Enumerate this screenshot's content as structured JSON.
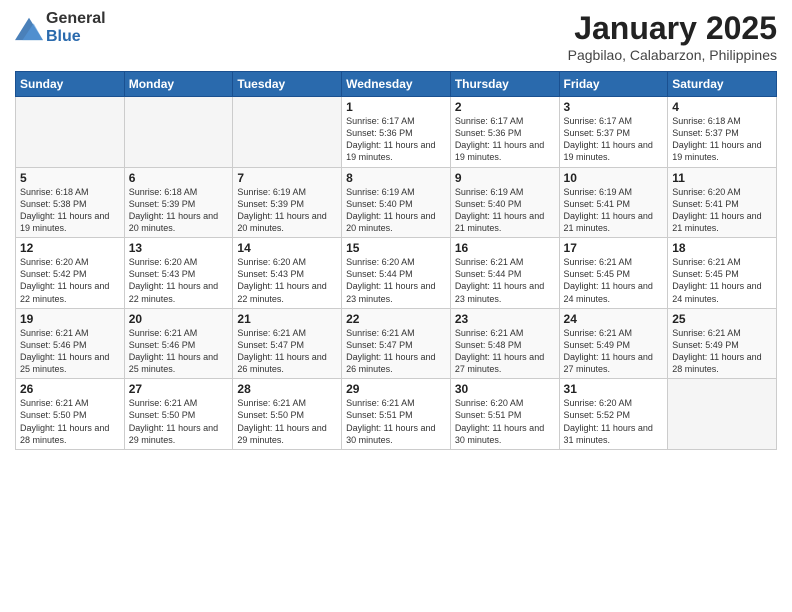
{
  "header": {
    "logo_general": "General",
    "logo_blue": "Blue",
    "title": "January 2025",
    "subtitle": "Pagbilao, Calabarzon, Philippines"
  },
  "calendar": {
    "days_of_week": [
      "Sunday",
      "Monday",
      "Tuesday",
      "Wednesday",
      "Thursday",
      "Friday",
      "Saturday"
    ],
    "weeks": [
      [
        {
          "day": "",
          "info": ""
        },
        {
          "day": "",
          "info": ""
        },
        {
          "day": "",
          "info": ""
        },
        {
          "day": "1",
          "info": "Sunrise: 6:17 AM\nSunset: 5:36 PM\nDaylight: 11 hours\nand 19 minutes."
        },
        {
          "day": "2",
          "info": "Sunrise: 6:17 AM\nSunset: 5:36 PM\nDaylight: 11 hours\nand 19 minutes."
        },
        {
          "day": "3",
          "info": "Sunrise: 6:17 AM\nSunset: 5:37 PM\nDaylight: 11 hours\nand 19 minutes."
        },
        {
          "day": "4",
          "info": "Sunrise: 6:18 AM\nSunset: 5:37 PM\nDaylight: 11 hours\nand 19 minutes."
        }
      ],
      [
        {
          "day": "5",
          "info": "Sunrise: 6:18 AM\nSunset: 5:38 PM\nDaylight: 11 hours\nand 19 minutes."
        },
        {
          "day": "6",
          "info": "Sunrise: 6:18 AM\nSunset: 5:39 PM\nDaylight: 11 hours\nand 20 minutes."
        },
        {
          "day": "7",
          "info": "Sunrise: 6:19 AM\nSunset: 5:39 PM\nDaylight: 11 hours\nand 20 minutes."
        },
        {
          "day": "8",
          "info": "Sunrise: 6:19 AM\nSunset: 5:40 PM\nDaylight: 11 hours\nand 20 minutes."
        },
        {
          "day": "9",
          "info": "Sunrise: 6:19 AM\nSunset: 5:40 PM\nDaylight: 11 hours\nand 21 minutes."
        },
        {
          "day": "10",
          "info": "Sunrise: 6:19 AM\nSunset: 5:41 PM\nDaylight: 11 hours\nand 21 minutes."
        },
        {
          "day": "11",
          "info": "Sunrise: 6:20 AM\nSunset: 5:41 PM\nDaylight: 11 hours\nand 21 minutes."
        }
      ],
      [
        {
          "day": "12",
          "info": "Sunrise: 6:20 AM\nSunset: 5:42 PM\nDaylight: 11 hours\nand 22 minutes."
        },
        {
          "day": "13",
          "info": "Sunrise: 6:20 AM\nSunset: 5:43 PM\nDaylight: 11 hours\nand 22 minutes."
        },
        {
          "day": "14",
          "info": "Sunrise: 6:20 AM\nSunset: 5:43 PM\nDaylight: 11 hours\nand 22 minutes."
        },
        {
          "day": "15",
          "info": "Sunrise: 6:20 AM\nSunset: 5:44 PM\nDaylight: 11 hours\nand 23 minutes."
        },
        {
          "day": "16",
          "info": "Sunrise: 6:21 AM\nSunset: 5:44 PM\nDaylight: 11 hours\nand 23 minutes."
        },
        {
          "day": "17",
          "info": "Sunrise: 6:21 AM\nSunset: 5:45 PM\nDaylight: 11 hours\nand 24 minutes."
        },
        {
          "day": "18",
          "info": "Sunrise: 6:21 AM\nSunset: 5:45 PM\nDaylight: 11 hours\nand 24 minutes."
        }
      ],
      [
        {
          "day": "19",
          "info": "Sunrise: 6:21 AM\nSunset: 5:46 PM\nDaylight: 11 hours\nand 25 minutes."
        },
        {
          "day": "20",
          "info": "Sunrise: 6:21 AM\nSunset: 5:46 PM\nDaylight: 11 hours\nand 25 minutes."
        },
        {
          "day": "21",
          "info": "Sunrise: 6:21 AM\nSunset: 5:47 PM\nDaylight: 11 hours\nand 26 minutes."
        },
        {
          "day": "22",
          "info": "Sunrise: 6:21 AM\nSunset: 5:47 PM\nDaylight: 11 hours\nand 26 minutes."
        },
        {
          "day": "23",
          "info": "Sunrise: 6:21 AM\nSunset: 5:48 PM\nDaylight: 11 hours\nand 27 minutes."
        },
        {
          "day": "24",
          "info": "Sunrise: 6:21 AM\nSunset: 5:49 PM\nDaylight: 11 hours\nand 27 minutes."
        },
        {
          "day": "25",
          "info": "Sunrise: 6:21 AM\nSunset: 5:49 PM\nDaylight: 11 hours\nand 28 minutes."
        }
      ],
      [
        {
          "day": "26",
          "info": "Sunrise: 6:21 AM\nSunset: 5:50 PM\nDaylight: 11 hours\nand 28 minutes."
        },
        {
          "day": "27",
          "info": "Sunrise: 6:21 AM\nSunset: 5:50 PM\nDaylight: 11 hours\nand 29 minutes."
        },
        {
          "day": "28",
          "info": "Sunrise: 6:21 AM\nSunset: 5:50 PM\nDaylight: 11 hours\nand 29 minutes."
        },
        {
          "day": "29",
          "info": "Sunrise: 6:21 AM\nSunset: 5:51 PM\nDaylight: 11 hours\nand 30 minutes."
        },
        {
          "day": "30",
          "info": "Sunrise: 6:20 AM\nSunset: 5:51 PM\nDaylight: 11 hours\nand 30 minutes."
        },
        {
          "day": "31",
          "info": "Sunrise: 6:20 AM\nSunset: 5:52 PM\nDaylight: 11 hours\nand 31 minutes."
        },
        {
          "day": "",
          "info": ""
        }
      ]
    ]
  }
}
